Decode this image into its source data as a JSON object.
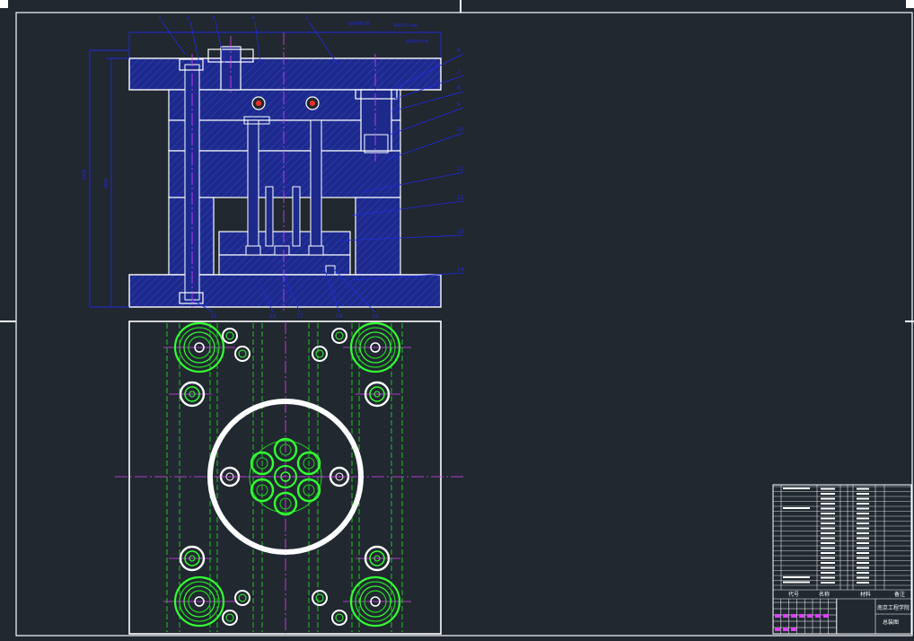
{
  "colors": {
    "background": "#212830",
    "frame": "#ffffff",
    "plate_fill": "#1d2a8c",
    "outline": "#ffffff",
    "dimension": "#1f2be0",
    "centerline": "#e040ff",
    "hidden": "#22d422",
    "bolt": "#33ff33",
    "red_accent": "#ff2a2a"
  },
  "leader_labels": {
    "top_left": [
      "1",
      "2",
      "3",
      "4",
      "5"
    ],
    "right": [
      "6",
      "7",
      "8",
      "9",
      "10",
      "11",
      "12",
      "13",
      "14"
    ],
    "bottom": [
      "15",
      "16",
      "17",
      "18",
      "19"
    ]
  },
  "tolerance_notes": [
    "Φ00H7/f6",
    "Φ00H7/m6",
    "Φ00H7/n6"
  ],
  "title_block": {
    "header": {
      "code": "代号",
      "name": "名称",
      "material": "材料",
      "remark": "备注"
    },
    "school": "南京工程学院",
    "drawing_title": "总装图"
  }
}
